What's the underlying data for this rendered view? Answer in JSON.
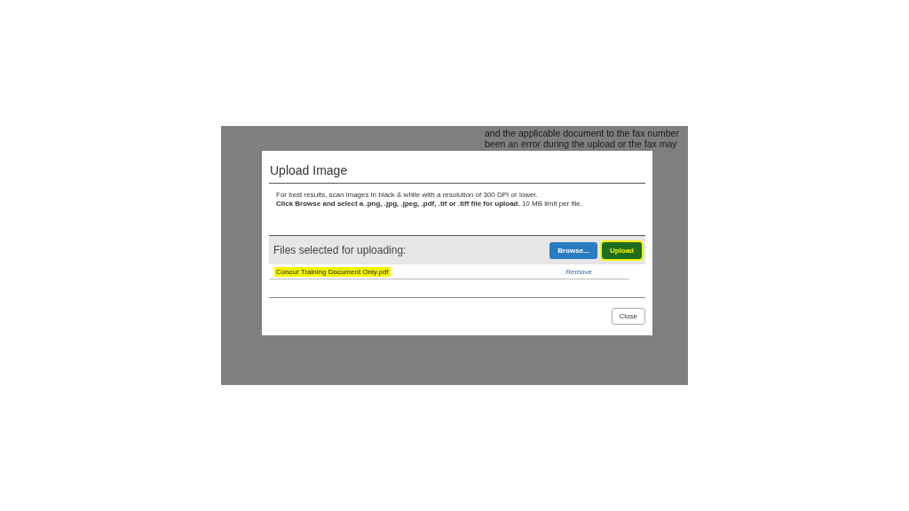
{
  "background_text": [
    "and the applicable document to the fax number",
    "been an error during the upload or the fax may"
  ],
  "dialog": {
    "title": "Upload Image",
    "instructions": [
      "For best results, scan images in black & white with a resolution of 300 DPI or lower.",
      "**Click Browse and select a .png, .jpg, .jpeg, .pdf, .tif or .tiff file for upload.** 10 MB limit per file."
    ],
    "files_heading": "Files selected for uploading:",
    "browse_button": "Browse...",
    "upload_button": {
      "label": "Upload",
      "highlighted": true
    },
    "files": [
      {
        "name": "Concur Training Document Only.pdf",
        "highlighted": true,
        "action": "Remove"
      }
    ],
    "close_button": "Close"
  }
}
